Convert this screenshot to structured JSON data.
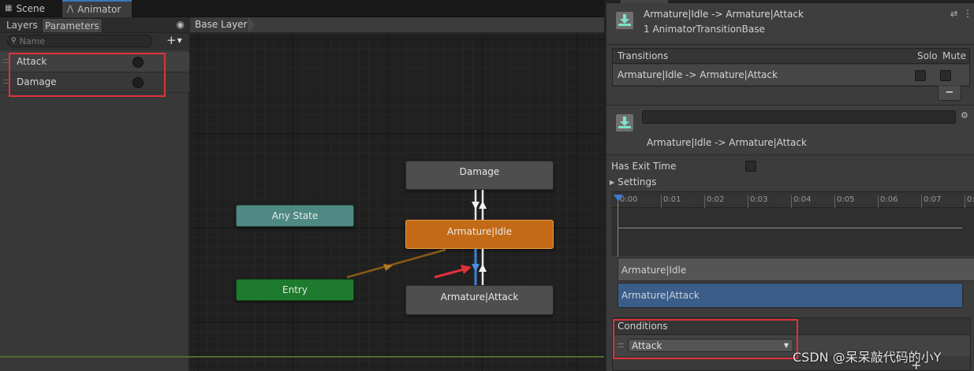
{
  "tabs": {
    "scene": "Scene",
    "animator": "Animator"
  },
  "left_panel": {
    "tabs": {
      "layers": "Layers",
      "parameters": "Parameters"
    },
    "search_placeholder": "Name",
    "add_label": "+",
    "parameters": [
      {
        "name": "Attack"
      },
      {
        "name": "Damage"
      }
    ]
  },
  "graph": {
    "breadcrumb": "Base Layer",
    "states": {
      "any_state": "Any State",
      "entry": "Entry",
      "damage": "Damage",
      "idle": "Armature|Idle",
      "attack": "Armature|Attack"
    },
    "colors": {
      "any_state": "#4e8a83",
      "entry": "#1e7a2d",
      "default_state": "#c36a16",
      "state": "#4e4e4e",
      "highlight": "#e0313a"
    }
  },
  "inspector": {
    "header_title": "Armature|Idle -> Armature|Attack",
    "header_subtitle": "1 AnimatorTransitionBase",
    "transitions": {
      "label": "Transitions",
      "solo": "Solo",
      "mute": "Mute",
      "rows": [
        {
          "name": "Armature|Idle -> Armature|Attack"
        }
      ],
      "remove_label": "−"
    },
    "transition": {
      "name_value": "",
      "label": "Armature|Idle -> Armature|Attack"
    },
    "has_exit_time_label": "Has Exit Time",
    "settings_label": "Settings",
    "timeline_ticks": [
      "0:00",
      "0:01",
      "0:02",
      "0:03",
      "0:04",
      "0:05",
      "0:06",
      "0:07",
      "0:"
    ],
    "tracks": {
      "source": "Armature|Idle",
      "destination": "Armature|Attack"
    },
    "conditions": {
      "label": "Conditions",
      "selected": "Attack"
    },
    "add_label": "+"
  },
  "watermark": "CSDN @呆呆敲代码的小Y"
}
